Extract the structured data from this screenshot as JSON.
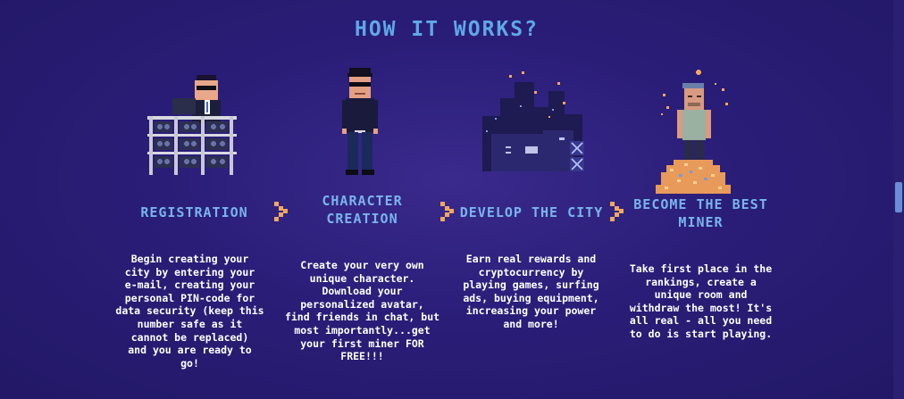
{
  "section_title": "HOW IT WORKS?",
  "steps": [
    {
      "title_lines": [
        "REGISTRATION"
      ],
      "description_lines": [
        "Begin creating your",
        "city by entering your",
        "e-mail, creating your",
        "personal PIN-code for",
        "data security (keep this",
        "number safe as it",
        "cannot be replaced)",
        "and you are ready to",
        "go!"
      ],
      "icon": "hacker-at-mining-rig"
    },
    {
      "title_lines": [
        "CHARACTER",
        "CREATION"
      ],
      "description_lines": [
        "Create your very own",
        "unique character.",
        "Download your",
        "personalized avatar,",
        "find friends in chat, but",
        "most importantly...get",
        "your first miner FOR",
        "FREE!!!"
      ],
      "icon": "pixel-character"
    },
    {
      "title_lines": [
        "DEVELOP THE CITY"
      ],
      "description_lines": [
        "Earn real rewards and",
        "cryptocurrency by",
        "playing games, surfing",
        "ads, buying equipment,",
        "increasing your power",
        "and more!"
      ],
      "icon": "pixel-city"
    },
    {
      "title_lines": [
        "BECOME THE BEST",
        "MINER"
      ],
      "description_lines": [
        "Take first place in the",
        "rankings, create a",
        "unique room and",
        "withdraw the most! It's",
        "all real - all you need",
        "to do is start playing."
      ],
      "icon": "miner-on-coin-pile"
    }
  ],
  "colors": {
    "background": "#2a1d78",
    "title": "#5fa8e8",
    "step_title": "#79b4ec",
    "arrow": "#f0a860",
    "text": "#ffffff"
  }
}
